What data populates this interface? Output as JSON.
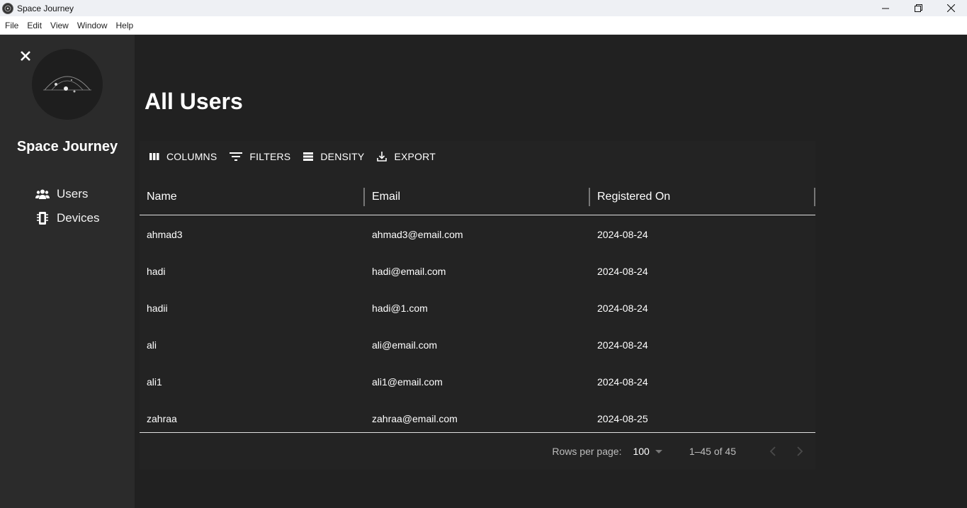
{
  "window": {
    "title": "Space Journey",
    "controls": {
      "minimize": "—",
      "maximize": "❐",
      "close": "✕"
    }
  },
  "menubar": {
    "items": [
      "File",
      "Edit",
      "View",
      "Window",
      "Help"
    ]
  },
  "sidebar": {
    "brand": "Space Journey",
    "close_icon": "close-icon",
    "items": [
      {
        "label": "Users",
        "icon": "users-icon"
      },
      {
        "label": "Devices",
        "icon": "devices-icon"
      }
    ]
  },
  "main": {
    "title": "All Users",
    "toolbar": {
      "columns": "COLUMNS",
      "filters": "FILTERS",
      "density": "DENSITY",
      "export": "EXPORT"
    },
    "table": {
      "headers": [
        "Name",
        "Email",
        "Registered On"
      ],
      "rows": [
        [
          "ahmad3",
          "ahmad3@email.com",
          "2024-08-24"
        ],
        [
          "hadi",
          "hadi@email.com",
          "2024-08-24"
        ],
        [
          "hadii",
          "hadi@1.com",
          "2024-08-24"
        ],
        [
          "ali",
          "ali@email.com",
          "2024-08-24"
        ],
        [
          "ali1",
          "ali1@email.com",
          "2024-08-24"
        ],
        [
          "zahraa",
          "zahraa@email.com",
          "2024-08-25"
        ]
      ]
    },
    "pagination": {
      "rows_per_page_label": "Rows per page:",
      "rows_per_page_value": "100",
      "page_info": "1–45 of 45"
    }
  },
  "colors": {
    "sidebar_bg": "#2b2b2b",
    "main_bg": "#212121",
    "text": "#ffffff"
  }
}
